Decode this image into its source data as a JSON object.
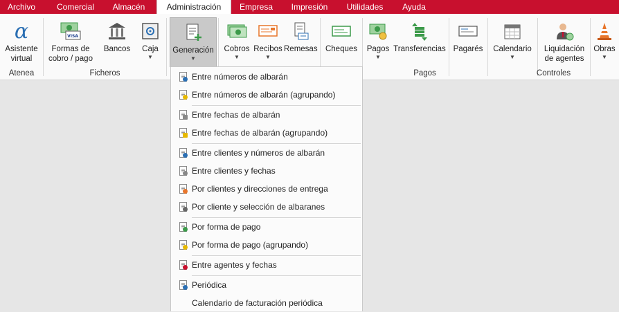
{
  "menu": {
    "tabs": [
      {
        "label": "Archivo",
        "active": false
      },
      {
        "label": "Comercial",
        "active": false
      },
      {
        "label": "Almacén",
        "active": false
      },
      {
        "label": "Administración",
        "active": true
      },
      {
        "label": "Empresa",
        "active": false
      },
      {
        "label": "Impresión",
        "active": false
      },
      {
        "label": "Utilidades",
        "active": false
      },
      {
        "label": "Ayuda",
        "active": false
      }
    ]
  },
  "ribbon": {
    "buttons": {
      "asistente": "Asistente virtual",
      "formas": "Formas de cobro / pago",
      "bancos": "Bancos",
      "caja": "Caja",
      "generacion": "Generación",
      "cobros": "Cobros",
      "recibos": "Recibos",
      "remesas": "Remesas",
      "cheques": "Cheques",
      "pagos": "Pagos",
      "transferencias": "Transferencias",
      "pagares": "Pagarés",
      "calendario": "Calendario",
      "liquidacion": "Liquidación de agentes",
      "obras": "Obras"
    },
    "groups": {
      "atenea": "Atenea",
      "ficheros": "Ficheros",
      "pagos": "Pagos",
      "controles": "Controles"
    }
  },
  "dropdown": {
    "items": [
      "Entre números de albarán",
      "Entre números de albarán (agrupando)",
      "Entre fechas de albarán",
      "Entre fechas de albarán (agrupando)",
      "Entre clientes y números de albarán",
      "Entre clientes y fechas",
      "Por clientes y direcciones de entrega",
      "Por cliente y selección de albaranes",
      "Por forma de pago",
      "Por forma de pago (agrupando)",
      "Entre agentes y fechas",
      "Periódica",
      "Calendario de facturación periódica"
    ]
  },
  "colors": {
    "brand_red": "#c8102e",
    "icon_green": "#3c9a4a",
    "icon_orange": "#e8762b",
    "icon_blue": "#2b6fb3"
  }
}
